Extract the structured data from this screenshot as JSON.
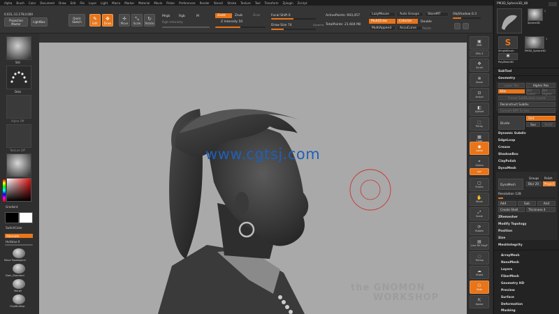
{
  "menubar": [
    "Alpha",
    "Brush",
    "Color",
    "Document",
    "Draw",
    "Edit",
    "File",
    "Layer",
    "Light",
    "Macro",
    "Marker",
    "Material",
    "Movie",
    "Picker",
    "Preferences",
    "Render",
    "Stencil",
    "Stroke",
    "Texture",
    "Tool",
    "Transform",
    "Zplugin",
    "Zscript"
  ],
  "toolbar": {
    "coords": "0.031,-11.179,0.000",
    "projection_master": "Projection Master",
    "lightbox": "LightBox",
    "quick_sketch": "Quick Sketch",
    "edit": "Edit",
    "draw": "Draw",
    "move": "Move",
    "scale": "Scale",
    "rotate": "Rotate",
    "mrgb": "Mrgb",
    "rgb": "Rgb",
    "m": "M",
    "rgb_intensity": "Rgb Intensity",
    "zadd": "Zadd",
    "zsub": "Zsub",
    "zcut": "Zcut",
    "z_intensity": "Z Intensity 50",
    "focal_shift": "Focal Shift 0",
    "draw_size": "Draw Size 74",
    "dynamic": "Dynamic",
    "active_points": "ActivePoints: 693,457",
    "total_points": "TotalPoints: 21.604 Mil",
    "lazy_mouse": "LazyMouse",
    "multidraw": "MultiDraw",
    "multiappend": "MultiAppend",
    "auto_groups": "Auto Groups",
    "colorize": "Colorize",
    "accucurve": "AccuCurve",
    "store_mt": "StoreMT",
    "double": "Double",
    "polish": "Polish",
    "obj_shadow": "ObjShadow 0.3"
  },
  "leftshelf": {
    "brush_label": "Std",
    "stroke_label": "Dots",
    "alpha_label": "Alpha Off",
    "texture_label": "Texture Off",
    "material_label": "BasicMat",
    "gradient": "Gradient",
    "switch_color": "SwitchColor",
    "alternate": "Alternate",
    "huevalue": "HuValue 0",
    "brushes": [
      "Move Topological",
      "Dam_Standard",
      "Morph",
      "ClayBuildup"
    ]
  },
  "rightshelf": [
    "BPR",
    "SPix 3",
    "Scroll",
    "Zoom",
    "Actual",
    "AAHalf",
    "Persp",
    "Floor",
    "Local",
    "Gizmo",
    "Frame",
    "Move",
    "Scale",
    "Rotate",
    "Line Fill PolyF",
    "Transp",
    "Ghost",
    "Solo",
    "Xpose"
  ],
  "palette": {
    "tool_name": "PM3D_Sphere3D_48",
    "tools": [
      "SimpleBrush",
      "Sphere3D",
      "PolyMesh3D",
      "PM3D_Sphere3D"
    ],
    "counts": [
      "2",
      "3"
    ],
    "subtool": "SubTool",
    "geometry": "Geometry",
    "higher_res": "Higher Res",
    "lower_res": "Lower Res",
    "sdiv": "SDiv",
    "del_lower": "Del Lower",
    "del_higher": "Del Higher",
    "freeze": "Freeze SubDivision Levels",
    "reconstruct": "Reconstruct Subdiv",
    "convert_bpr": "Convert BPR To Geo",
    "divide": "Divide",
    "smt": "Smt",
    "suv": "Suv",
    "reuv": "ReUV",
    "dynamic_subdiv": "Dynamic Subdiv",
    "edgeloop": "EdgeLoop",
    "crease": "Crease",
    "shadowbox": "ShadowBox",
    "claypolish": "ClayPolish",
    "dynamesh": "DynaMesh",
    "dynamesh_btn": "DynaMesh",
    "groups": "Groups",
    "polish": "Polish",
    "blur": "Blur 20",
    "project": "Project",
    "resolution": "Resolution 128",
    "add": "Add",
    "sub": "Sub",
    "and": "And",
    "create_shell": "Create Shell",
    "thickness": "Thickness 4",
    "zremesher": "ZRemesher",
    "modify_topology": "Modify Topology",
    "position": "Position",
    "size": "Size",
    "meshintegrity": "MeshIntegrity",
    "arraymesh": "ArrayMesh",
    "nanomesh": "NanoMesh",
    "layers": "Layers",
    "fibermesh": "FiberMesh",
    "geometry_hd": "Geometry HD",
    "preview": "Preview",
    "surface": "Surface",
    "deformation": "Deformation",
    "masking": "Masking"
  },
  "canvas": {
    "watermark": "www.cgtsj.com",
    "logo_line1": "the GNOMON",
    "logo_line2": "WORKSHOP"
  },
  "colors": {
    "accent": "#e8751a",
    "canvas": "#a9a9a9",
    "brush_circle": "#d03030"
  }
}
